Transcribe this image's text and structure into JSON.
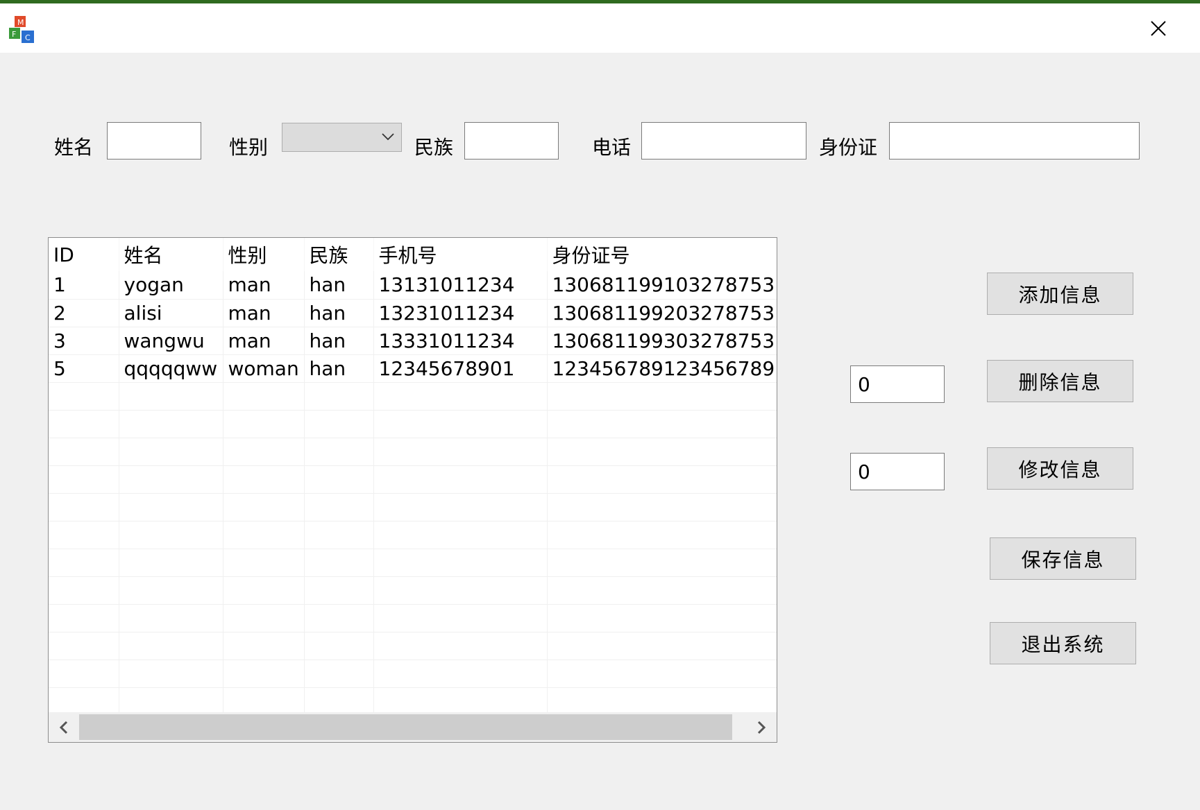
{
  "form": {
    "name_label": "姓名",
    "name_value": "",
    "gender_label": "性别",
    "gender_value": "",
    "ethnicity_label": "民族",
    "ethnicity_value": "",
    "phone_label": "电话",
    "phone_value": "",
    "id_card_label": "身份证",
    "id_card_value": ""
  },
  "table": {
    "columns": [
      "ID",
      "姓名",
      "性别",
      "民族",
      "手机号",
      "身份证号"
    ],
    "rows": [
      [
        "1",
        "yogan",
        "man",
        "han",
        "13131011234",
        "130681199103278753"
      ],
      [
        "2",
        "alisi",
        "man",
        "han",
        "13231011234",
        "130681199203278753"
      ],
      [
        "3",
        "wangwu",
        "man",
        "han",
        "13331011234",
        "130681199303278753"
      ],
      [
        "5",
        "qqqqqww",
        "woman",
        "han",
        "12345678901",
        "123456789123456789"
      ]
    ]
  },
  "actions": {
    "add_label": "添加信息",
    "delete_index": "0",
    "delete_label": "删除信息",
    "modify_index": "0",
    "modify_label": "修改信息",
    "save_label": "保存信息",
    "exit_label": "退出系统"
  },
  "icons": {
    "app": "mfc-app-icon",
    "close": "close-icon",
    "dropdown": "chevron-down-icon",
    "scroll_left": "chevron-left-icon",
    "scroll_right": "chevron-right-icon"
  },
  "colors": {
    "window_bg": "#f0f0f0",
    "titlebar_bg": "#ffffff",
    "button_bg": "#e1e1e1",
    "window_border": "#2f6b1f"
  }
}
